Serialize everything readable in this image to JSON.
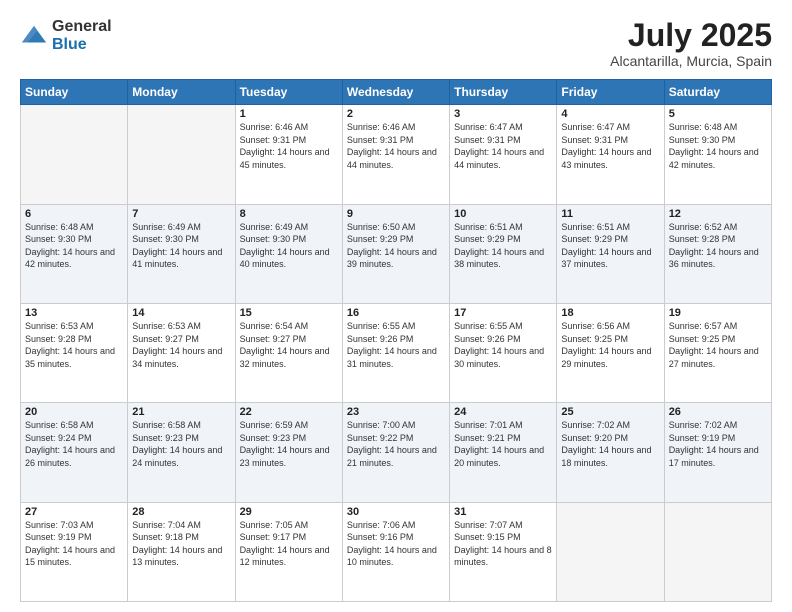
{
  "logo": {
    "general": "General",
    "blue": "Blue"
  },
  "title": "July 2025",
  "subtitle": "Alcantarilla, Murcia, Spain",
  "days_header": [
    "Sunday",
    "Monday",
    "Tuesday",
    "Wednesday",
    "Thursday",
    "Friday",
    "Saturday"
  ],
  "weeks": [
    [
      {
        "day": "",
        "sunrise": "",
        "sunset": "",
        "daylight": "",
        "empty": true
      },
      {
        "day": "",
        "sunrise": "",
        "sunset": "",
        "daylight": "",
        "empty": true
      },
      {
        "day": "1",
        "sunrise": "Sunrise: 6:46 AM",
        "sunset": "Sunset: 9:31 PM",
        "daylight": "Daylight: 14 hours and 45 minutes.",
        "empty": false
      },
      {
        "day": "2",
        "sunrise": "Sunrise: 6:46 AM",
        "sunset": "Sunset: 9:31 PM",
        "daylight": "Daylight: 14 hours and 44 minutes.",
        "empty": false
      },
      {
        "day": "3",
        "sunrise": "Sunrise: 6:47 AM",
        "sunset": "Sunset: 9:31 PM",
        "daylight": "Daylight: 14 hours and 44 minutes.",
        "empty": false
      },
      {
        "day": "4",
        "sunrise": "Sunrise: 6:47 AM",
        "sunset": "Sunset: 9:31 PM",
        "daylight": "Daylight: 14 hours and 43 minutes.",
        "empty": false
      },
      {
        "day": "5",
        "sunrise": "Sunrise: 6:48 AM",
        "sunset": "Sunset: 9:30 PM",
        "daylight": "Daylight: 14 hours and 42 minutes.",
        "empty": false
      }
    ],
    [
      {
        "day": "6",
        "sunrise": "Sunrise: 6:48 AM",
        "sunset": "Sunset: 9:30 PM",
        "daylight": "Daylight: 14 hours and 42 minutes.",
        "empty": false
      },
      {
        "day": "7",
        "sunrise": "Sunrise: 6:49 AM",
        "sunset": "Sunset: 9:30 PM",
        "daylight": "Daylight: 14 hours and 41 minutes.",
        "empty": false
      },
      {
        "day": "8",
        "sunrise": "Sunrise: 6:49 AM",
        "sunset": "Sunset: 9:30 PM",
        "daylight": "Daylight: 14 hours and 40 minutes.",
        "empty": false
      },
      {
        "day": "9",
        "sunrise": "Sunrise: 6:50 AM",
        "sunset": "Sunset: 9:29 PM",
        "daylight": "Daylight: 14 hours and 39 minutes.",
        "empty": false
      },
      {
        "day": "10",
        "sunrise": "Sunrise: 6:51 AM",
        "sunset": "Sunset: 9:29 PM",
        "daylight": "Daylight: 14 hours and 38 minutes.",
        "empty": false
      },
      {
        "day": "11",
        "sunrise": "Sunrise: 6:51 AM",
        "sunset": "Sunset: 9:29 PM",
        "daylight": "Daylight: 14 hours and 37 minutes.",
        "empty": false
      },
      {
        "day": "12",
        "sunrise": "Sunrise: 6:52 AM",
        "sunset": "Sunset: 9:28 PM",
        "daylight": "Daylight: 14 hours and 36 minutes.",
        "empty": false
      }
    ],
    [
      {
        "day": "13",
        "sunrise": "Sunrise: 6:53 AM",
        "sunset": "Sunset: 9:28 PM",
        "daylight": "Daylight: 14 hours and 35 minutes.",
        "empty": false
      },
      {
        "day": "14",
        "sunrise": "Sunrise: 6:53 AM",
        "sunset": "Sunset: 9:27 PM",
        "daylight": "Daylight: 14 hours and 34 minutes.",
        "empty": false
      },
      {
        "day": "15",
        "sunrise": "Sunrise: 6:54 AM",
        "sunset": "Sunset: 9:27 PM",
        "daylight": "Daylight: 14 hours and 32 minutes.",
        "empty": false
      },
      {
        "day": "16",
        "sunrise": "Sunrise: 6:55 AM",
        "sunset": "Sunset: 9:26 PM",
        "daylight": "Daylight: 14 hours and 31 minutes.",
        "empty": false
      },
      {
        "day": "17",
        "sunrise": "Sunrise: 6:55 AM",
        "sunset": "Sunset: 9:26 PM",
        "daylight": "Daylight: 14 hours and 30 minutes.",
        "empty": false
      },
      {
        "day": "18",
        "sunrise": "Sunrise: 6:56 AM",
        "sunset": "Sunset: 9:25 PM",
        "daylight": "Daylight: 14 hours and 29 minutes.",
        "empty": false
      },
      {
        "day": "19",
        "sunrise": "Sunrise: 6:57 AM",
        "sunset": "Sunset: 9:25 PM",
        "daylight": "Daylight: 14 hours and 27 minutes.",
        "empty": false
      }
    ],
    [
      {
        "day": "20",
        "sunrise": "Sunrise: 6:58 AM",
        "sunset": "Sunset: 9:24 PM",
        "daylight": "Daylight: 14 hours and 26 minutes.",
        "empty": false
      },
      {
        "day": "21",
        "sunrise": "Sunrise: 6:58 AM",
        "sunset": "Sunset: 9:23 PM",
        "daylight": "Daylight: 14 hours and 24 minutes.",
        "empty": false
      },
      {
        "day": "22",
        "sunrise": "Sunrise: 6:59 AM",
        "sunset": "Sunset: 9:23 PM",
        "daylight": "Daylight: 14 hours and 23 minutes.",
        "empty": false
      },
      {
        "day": "23",
        "sunrise": "Sunrise: 7:00 AM",
        "sunset": "Sunset: 9:22 PM",
        "daylight": "Daylight: 14 hours and 21 minutes.",
        "empty": false
      },
      {
        "day": "24",
        "sunrise": "Sunrise: 7:01 AM",
        "sunset": "Sunset: 9:21 PM",
        "daylight": "Daylight: 14 hours and 20 minutes.",
        "empty": false
      },
      {
        "day": "25",
        "sunrise": "Sunrise: 7:02 AM",
        "sunset": "Sunset: 9:20 PM",
        "daylight": "Daylight: 14 hours and 18 minutes.",
        "empty": false
      },
      {
        "day": "26",
        "sunrise": "Sunrise: 7:02 AM",
        "sunset": "Sunset: 9:19 PM",
        "daylight": "Daylight: 14 hours and 17 minutes.",
        "empty": false
      }
    ],
    [
      {
        "day": "27",
        "sunrise": "Sunrise: 7:03 AM",
        "sunset": "Sunset: 9:19 PM",
        "daylight": "Daylight: 14 hours and 15 minutes.",
        "empty": false
      },
      {
        "day": "28",
        "sunrise": "Sunrise: 7:04 AM",
        "sunset": "Sunset: 9:18 PM",
        "daylight": "Daylight: 14 hours and 13 minutes.",
        "empty": false
      },
      {
        "day": "29",
        "sunrise": "Sunrise: 7:05 AM",
        "sunset": "Sunset: 9:17 PM",
        "daylight": "Daylight: 14 hours and 12 minutes.",
        "empty": false
      },
      {
        "day": "30",
        "sunrise": "Sunrise: 7:06 AM",
        "sunset": "Sunset: 9:16 PM",
        "daylight": "Daylight: 14 hours and 10 minutes.",
        "empty": false
      },
      {
        "day": "31",
        "sunrise": "Sunrise: 7:07 AM",
        "sunset": "Sunset: 9:15 PM",
        "daylight": "Daylight: 14 hours and 8 minutes.",
        "empty": false
      },
      {
        "day": "",
        "sunrise": "",
        "sunset": "",
        "daylight": "",
        "empty": true
      },
      {
        "day": "",
        "sunrise": "",
        "sunset": "",
        "daylight": "",
        "empty": true
      }
    ]
  ]
}
